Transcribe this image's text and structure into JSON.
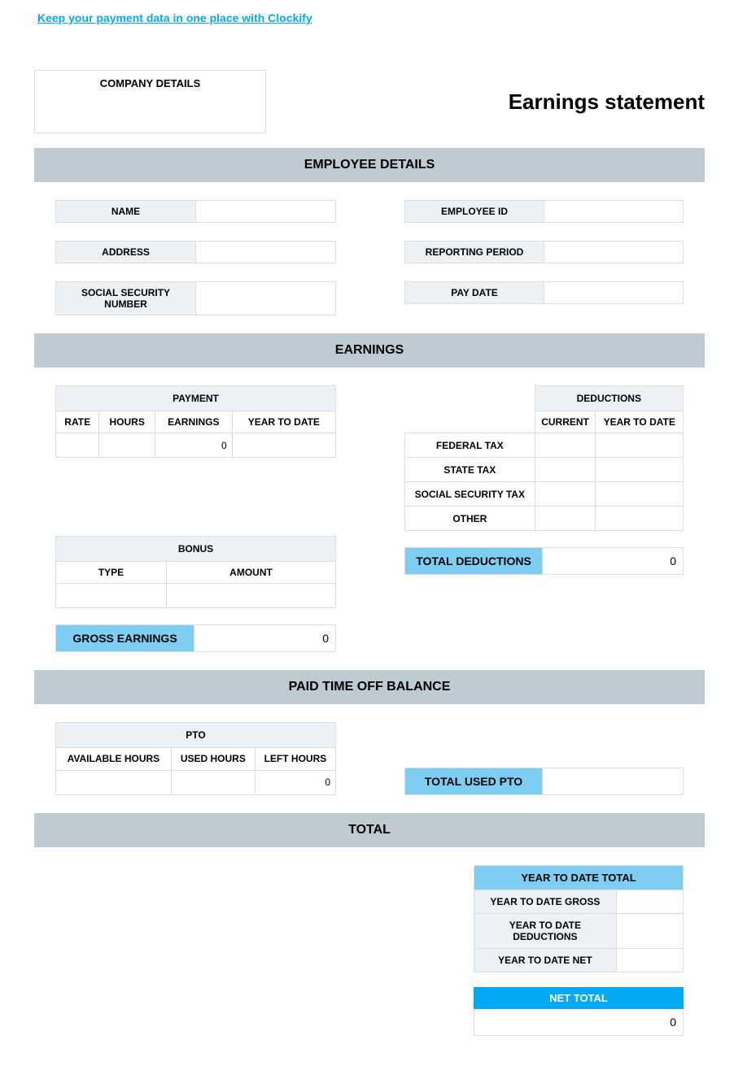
{
  "link": {
    "text": "Keep your payment data in one place with Clockify"
  },
  "company": {
    "label": "COMPANY DETAILS",
    "value": ""
  },
  "title": "Earnings statement",
  "employee_section": {
    "header": "EMPLOYEE DETAILS",
    "left": [
      {
        "label": "NAME",
        "value": ""
      },
      {
        "label": "ADDRESS",
        "value": ""
      },
      {
        "label": "SOCIAL SECURITY NUMBER",
        "value": ""
      }
    ],
    "right": [
      {
        "label": "EMPLOYEE ID",
        "value": ""
      },
      {
        "label": "REPORTING PERIOD",
        "value": ""
      },
      {
        "label": "PAY DATE",
        "value": ""
      }
    ]
  },
  "earnings_section": {
    "header": "EARNINGS",
    "payment": {
      "title": "PAYMENT",
      "cols": [
        "RATE",
        "HOURS",
        "EARNINGS",
        "YEAR TO DATE"
      ],
      "row": {
        "rate": "",
        "hours": "",
        "earnings": "0",
        "ytd": ""
      }
    },
    "bonus": {
      "title": "BONUS",
      "cols": [
        "TYPE",
        "AMOUNT"
      ],
      "row": {
        "type": "",
        "amount": ""
      }
    },
    "deductions": {
      "title": "DEDUCTIONS",
      "cols": [
        "CURRENT",
        "YEAR TO DATE"
      ],
      "rows": [
        {
          "label": "FEDERAL TAX",
          "current": "",
          "ytd": ""
        },
        {
          "label": "STATE TAX",
          "current": "",
          "ytd": ""
        },
        {
          "label": "SOCIAL SECURITY TAX",
          "current": "",
          "ytd": ""
        },
        {
          "label": "OTHER",
          "current": "",
          "ytd": ""
        }
      ]
    },
    "gross": {
      "label": "GROSS EARNINGS",
      "value": "0"
    },
    "total_ded": {
      "label": "TOTAL DEDUCTIONS",
      "value": "0"
    }
  },
  "pto_section": {
    "header": "PAID TIME OFF BALANCE",
    "table": {
      "title": "PTO",
      "cols": [
        "AVAILABLE HOURS",
        "USED HOURS",
        "LEFT HOURS"
      ],
      "row": {
        "available": "",
        "used": "",
        "left": "0"
      }
    },
    "total_used": {
      "label": "TOTAL USED PTO",
      "value": ""
    }
  },
  "total_section": {
    "header": "TOTAL",
    "ytd": {
      "title": "YEAR TO DATE TOTAL",
      "rows": [
        {
          "label": "YEAR TO DATE GROSS",
          "value": ""
        },
        {
          "label": "YEAR TO DATE DEDUCTIONS",
          "value": ""
        },
        {
          "label": "YEAR TO DATE NET",
          "value": ""
        }
      ]
    },
    "net": {
      "label": "NET TOTAL",
      "value": "0"
    }
  }
}
